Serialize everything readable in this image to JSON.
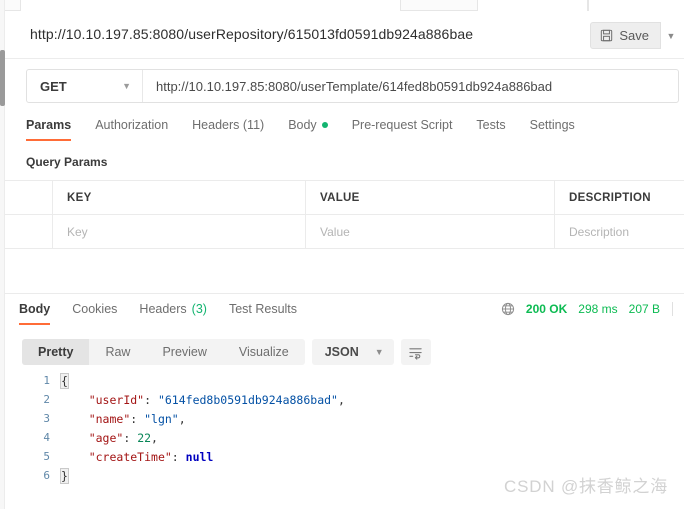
{
  "window": {
    "tabstrip_tabs": [
      "",
      "",
      ""
    ]
  },
  "request_header": {
    "title": "http://10.10.197.85:8080/userRepository/615013fd0591db924a886bae",
    "save_label": "Save",
    "save_icon": "floppy-disk-icon",
    "save_caret_icon": "chevron-down-icon"
  },
  "url_bar": {
    "method": "GET",
    "method_caret_icon": "chevron-down-icon",
    "url": "http://10.10.197.85:8080/userTemplate/614fed8b0591db924a886bad"
  },
  "request_tabs": [
    {
      "label": "Params",
      "active": true
    },
    {
      "label": "Authorization",
      "active": false
    },
    {
      "label": "Headers (11)",
      "active": false
    },
    {
      "label": "Body",
      "active": false,
      "indicator": "green-dot"
    },
    {
      "label": "Pre-request Script",
      "active": false
    },
    {
      "label": "Tests",
      "active": false
    },
    {
      "label": "Settings",
      "active": false
    }
  ],
  "params": {
    "section_label": "Query Params",
    "columns": [
      "KEY",
      "VALUE",
      "DESCRIPTION"
    ],
    "empty_row": {
      "key_placeholder": "Key",
      "value_placeholder": "Value",
      "description_placeholder": "Description"
    }
  },
  "response_tabs": [
    {
      "label": "Body",
      "active": true
    },
    {
      "label": "Cookies",
      "active": false
    },
    {
      "label": "Headers",
      "count": "(3)",
      "active": false
    },
    {
      "label": "Test Results",
      "active": false
    }
  ],
  "response_status": {
    "globe_icon": "globe-icon",
    "status": "200 OK",
    "time": "298 ms",
    "size": "207 B",
    "status_color": "#0cbb52"
  },
  "format_bar": {
    "views": [
      {
        "label": "Pretty",
        "active": true
      },
      {
        "label": "Raw",
        "active": false
      },
      {
        "label": "Preview",
        "active": false
      },
      {
        "label": "Visualize",
        "active": false
      }
    ],
    "language": "JSON",
    "language_caret_icon": "chevron-down-icon",
    "wrap_icon": "wrap-lines-icon"
  },
  "response_body": {
    "lines": [
      {
        "n": "1",
        "segments": [
          {
            "t": "pn",
            "v": "{",
            "hl": true
          }
        ]
      },
      {
        "n": "2",
        "segments": [
          {
            "t": "plain",
            "v": "    "
          },
          {
            "t": "key",
            "v": "\"userId\""
          },
          {
            "t": "pn",
            "v": ": "
          },
          {
            "t": "str",
            "v": "\"614fed8b0591db924a886bad\""
          },
          {
            "t": "pn",
            "v": ","
          }
        ]
      },
      {
        "n": "3",
        "segments": [
          {
            "t": "plain",
            "v": "    "
          },
          {
            "t": "key",
            "v": "\"name\""
          },
          {
            "t": "pn",
            "v": ": "
          },
          {
            "t": "str",
            "v": "\"lgn\""
          },
          {
            "t": "pn",
            "v": ","
          }
        ]
      },
      {
        "n": "4",
        "segments": [
          {
            "t": "plain",
            "v": "    "
          },
          {
            "t": "key",
            "v": "\"age\""
          },
          {
            "t": "pn",
            "v": ": "
          },
          {
            "t": "num",
            "v": "22"
          },
          {
            "t": "pn",
            "v": ","
          }
        ]
      },
      {
        "n": "5",
        "segments": [
          {
            "t": "plain",
            "v": "    "
          },
          {
            "t": "key",
            "v": "\"createTime\""
          },
          {
            "t": "pn",
            "v": ": "
          },
          {
            "t": "null",
            "v": "null"
          }
        ]
      },
      {
        "n": "6",
        "segments": [
          {
            "t": "pn",
            "v": "}",
            "hl": true
          }
        ]
      }
    ]
  },
  "watermark": {
    "text": "CSDN @抹香鲸之海"
  }
}
